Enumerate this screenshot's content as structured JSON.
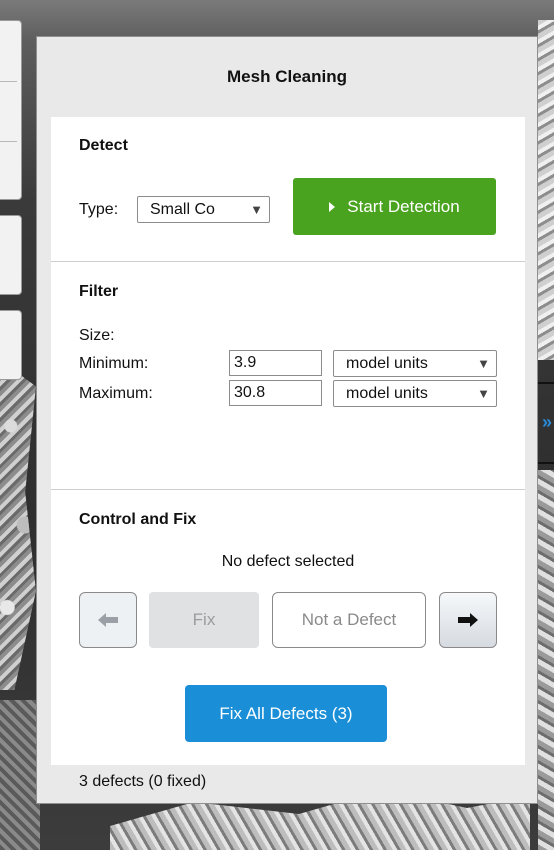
{
  "panel": {
    "title": "Mesh Cleaning",
    "detect": {
      "title": "Detect",
      "type_label": "Type:",
      "type_value": "Small Co",
      "start_button": "Start Detection"
    },
    "filter": {
      "title": "Filter",
      "size_label": "Size:",
      "minimum_label": "Minimum:",
      "minimum_value": "3.9",
      "minimum_unit": "model units",
      "maximum_label": "Maximum:",
      "maximum_value": "30.8",
      "maximum_unit": "model units"
    },
    "control": {
      "title": "Control and Fix",
      "selection_status": "No defect selected",
      "fix_button": "Fix",
      "not_defect_button": "Not a Defect",
      "fix_all_button": "Fix All Defects (3)"
    },
    "status_text": "3 defects (0 fixed)"
  },
  "colors": {
    "detect_button": "#4aa31f",
    "fix_all_button": "#1a8fd8",
    "accent_chevron": "#2a8ad6"
  },
  "icons": {
    "prev": "arrow-left-icon",
    "next": "arrow-right-icon",
    "play": "play-icon",
    "dropdown": "chevron-down-icon",
    "collapse": "chevron-right-icon"
  }
}
